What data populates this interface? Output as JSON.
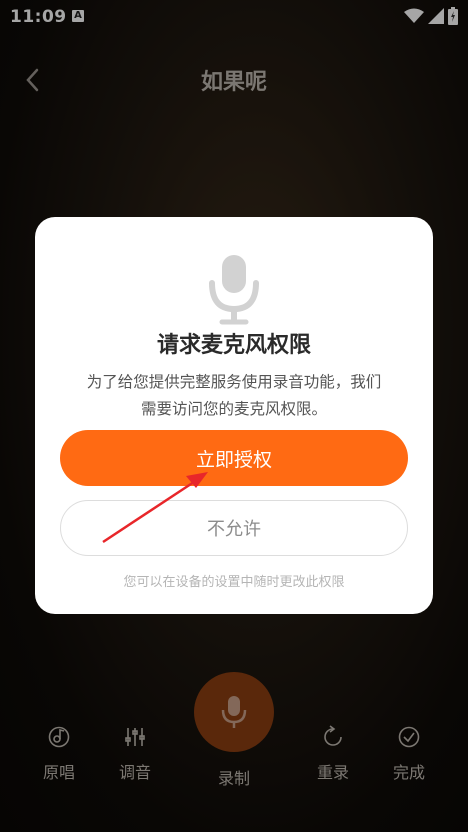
{
  "status_bar": {
    "time": "11:09",
    "notif_letter": "A"
  },
  "nav": {
    "title": "如果呢",
    "back_icon": "chevron-left-icon"
  },
  "dialog": {
    "icon": "microphone-icon",
    "title": "请求麦克风权限",
    "description_line1": "为了给您提供完整服务使用录音功能，我们",
    "description_line2": "需要访问您的麦克风权限。",
    "allow_label": "立即授权",
    "deny_label": "不允许",
    "hint": "您可以在设备的设置中随时更改此权限",
    "accent_color": "#ff6a13"
  },
  "toolbar": {
    "original_label": "原唱",
    "tune_label": "调音",
    "record_label": "录制",
    "rerecord_label": "重录",
    "done_label": "完成"
  },
  "annotation": {
    "arrow_color": "#e8262a"
  }
}
